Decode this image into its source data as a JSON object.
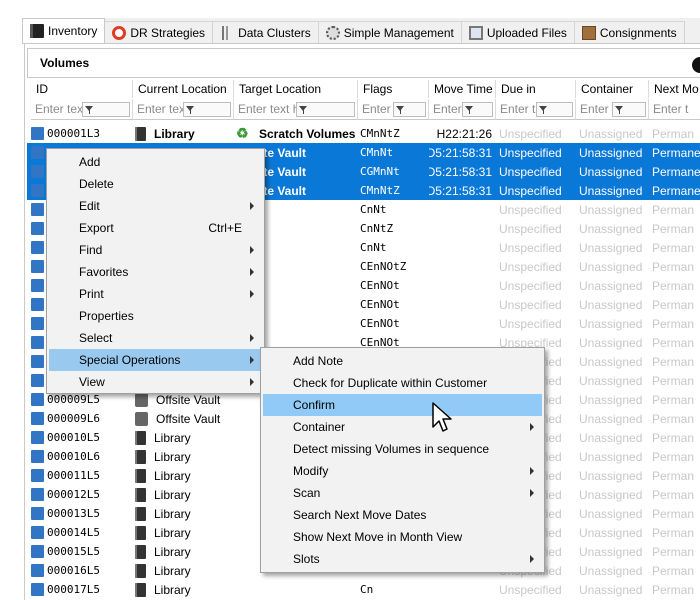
{
  "tabs": [
    {
      "label": "Inventory",
      "icon": "book-icon"
    },
    {
      "label": "DR Strategies",
      "icon": "lifebuoy-icon"
    },
    {
      "label": "Data Clusters",
      "icon": "bar-chart-icon"
    },
    {
      "label": "Simple Management",
      "icon": "gear-icon"
    },
    {
      "label": "Uploaded Files",
      "icon": "monitor-icon"
    },
    {
      "label": "Consignments",
      "icon": "box-icon"
    }
  ],
  "panel": {
    "title": "Volumes"
  },
  "columns": [
    {
      "label": "ID",
      "filter": "Enter text h..."
    },
    {
      "label": "Current Location",
      "filter": "Enter text h..."
    },
    {
      "label": "Target Location",
      "filter": "Enter text here"
    },
    {
      "label": "Flags",
      "filter": "Enter ..."
    },
    {
      "label": "Move Time",
      "filter": "Enter t..."
    },
    {
      "label": "Due in",
      "filter": "Enter t..."
    },
    {
      "label": "Container",
      "filter": "Enter t..."
    },
    {
      "label": "Next Mo",
      "filter": "Enter t"
    }
  ],
  "rows": [
    {
      "id": "000001L3",
      "current": "Library",
      "target": "Scratch Volumes",
      "flags": "CMnNtZ",
      "move": "H22:21:26",
      "due": "Unspecified",
      "container": "Unassigned",
      "next": "Perman"
    },
    {
      "id": "",
      "current": "",
      "target": "Offsite Vault",
      "flags": "CMnNt",
      "move": "D5:21:58:31",
      "due": "Unspecified",
      "container": "Unassigned",
      "next": "Permane"
    },
    {
      "id": "",
      "current": "",
      "target": "Offsite Vault",
      "flags": "CGMnNt",
      "move": "D5:21:58:31",
      "due": "Unspecified",
      "container": "Unassigned",
      "next": "Permane"
    },
    {
      "id": "",
      "current": "",
      "target": "Offsite Vault",
      "flags": "CMnNtZ",
      "move": "D5:21:58:31",
      "due": "Unspecified",
      "container": "Unassigned",
      "next": "Permane"
    },
    {
      "id": "",
      "current": "",
      "target": "",
      "flags": "CnNt",
      "move": "",
      "due": "Unspecified",
      "container": "Unassigned",
      "next": "Perman"
    },
    {
      "id": "",
      "current": "",
      "target": "",
      "flags": "CnNtZ",
      "move": "",
      "due": "Unspecified",
      "container": "Unassigned",
      "next": "Perman"
    },
    {
      "id": "",
      "current": "",
      "target": "",
      "flags": "CnNt",
      "move": "",
      "due": "Unspecified",
      "container": "Unassigned",
      "next": "Perman"
    },
    {
      "id": "",
      "current": "",
      "target": "",
      "flags": "CEnNOtZ",
      "move": "",
      "due": "Unspecified",
      "container": "Unassigned",
      "next": "Perman"
    },
    {
      "id": "",
      "current": "",
      "target": "",
      "flags": "CEnNOt",
      "move": "",
      "due": "Unspecified",
      "container": "Unassigned",
      "next": "Perman"
    },
    {
      "id": "",
      "current": "",
      "target": "",
      "flags": "CEnNOt",
      "move": "",
      "due": "Unspecified",
      "container": "Unassigned",
      "next": "Perman"
    },
    {
      "id": "",
      "current": "",
      "target": "",
      "flags": "CEnNOt",
      "move": "",
      "due": "Unspecified",
      "container": "Unassigned",
      "next": "Perman"
    },
    {
      "id": "",
      "current": "",
      "target": "",
      "flags": "CEnNOt",
      "move": "",
      "due": "Unspecified",
      "container": "Unassigned",
      "next": "Perman"
    },
    {
      "id": "",
      "current": "",
      "target": "",
      "flags": "",
      "move": "",
      "due": "Unspecified",
      "container": "Unassigned",
      "next": "Perman"
    },
    {
      "id": "",
      "current": "",
      "target": "",
      "flags": "",
      "move": "",
      "due": "Unspecified",
      "container": "Unassigned",
      "next": "Perman"
    },
    {
      "id": "000009L5",
      "current": "Offsite Vault",
      "target": "",
      "flags": "",
      "move": "",
      "due": "Unspecified",
      "container": "Unassigned",
      "next": "Perman"
    },
    {
      "id": "000009L6",
      "current": "Offsite Vault",
      "target": "",
      "flags": "",
      "move": "",
      "due": "Unspecified",
      "container": "Unassigned",
      "next": "Perman"
    },
    {
      "id": "000010L5",
      "current": "Library",
      "target": "",
      "flags": "",
      "move": "",
      "due": "Unspecified",
      "container": "Unassigned",
      "next": "Perman"
    },
    {
      "id": "000010L6",
      "current": "Library",
      "target": "",
      "flags": "",
      "move": "",
      "due": "Unspecified",
      "container": "Unassigned",
      "next": "Perman"
    },
    {
      "id": "000011L5",
      "current": "Library",
      "target": "",
      "flags": "",
      "move": "",
      "due": "Unspecified",
      "container": "Unassigned",
      "next": "Perman"
    },
    {
      "id": "000012L5",
      "current": "Library",
      "target": "",
      "flags": "",
      "move": "",
      "due": "Unspecified",
      "container": "Unassigned",
      "next": "Perman"
    },
    {
      "id": "000013L5",
      "current": "Library",
      "target": "",
      "flags": "",
      "move": "",
      "due": "Unspecified",
      "container": "Unassigned",
      "next": "Perman"
    },
    {
      "id": "000014L5",
      "current": "Library",
      "target": "",
      "flags": "",
      "move": "",
      "due": "Unspecified",
      "container": "Unassigned",
      "next": "Perman"
    },
    {
      "id": "000015L5",
      "current": "Library",
      "target": "",
      "flags": "",
      "move": "",
      "due": "Unspecified",
      "container": "Unassigned",
      "next": "Perman"
    },
    {
      "id": "000016L5",
      "current": "Library",
      "target": "",
      "flags": "",
      "move": "",
      "due": "Unspecified",
      "container": "Unassigned",
      "next": "Perman"
    },
    {
      "id": "000017L5",
      "current": "Library",
      "target": "",
      "flags": "Cn",
      "move": "",
      "due": "Unspecified",
      "container": "Unassigned",
      "next": "Perman"
    }
  ],
  "context_menu": [
    {
      "label": "Add",
      "shortcut": "",
      "submenu": false
    },
    {
      "label": "Delete",
      "shortcut": "",
      "submenu": false
    },
    {
      "label": "Edit",
      "shortcut": "",
      "submenu": true
    },
    {
      "label": "Export",
      "shortcut": "Ctrl+E",
      "submenu": false
    },
    {
      "label": "Find",
      "shortcut": "",
      "submenu": true
    },
    {
      "label": "Favorites",
      "shortcut": "",
      "submenu": true
    },
    {
      "label": "Print",
      "shortcut": "",
      "submenu": true
    },
    {
      "label": "Properties",
      "shortcut": "",
      "submenu": false
    },
    {
      "label": "Select",
      "shortcut": "",
      "submenu": true
    },
    {
      "label": "Special Operations",
      "shortcut": "",
      "submenu": true
    },
    {
      "label": "View",
      "shortcut": "",
      "submenu": true
    }
  ],
  "submenu": [
    {
      "label": "Add Note",
      "submenu": false
    },
    {
      "label": "Check for Duplicate within Customer",
      "submenu": false
    },
    {
      "label": "Confirm",
      "submenu": false
    },
    {
      "label": "Container",
      "submenu": true
    },
    {
      "label": "Detect missing Volumes in sequence",
      "submenu": false
    },
    {
      "label": "Modify",
      "submenu": true
    },
    {
      "label": "Scan",
      "submenu": true
    },
    {
      "label": "Search Next Move Dates",
      "submenu": false
    },
    {
      "label": "Show Next Move in Month View",
      "submenu": false
    },
    {
      "label": "Slots",
      "submenu": true
    }
  ],
  "colors": {
    "selection": "#0a78d7",
    "menu_highlight": "#99c9ef",
    "menu_bg": "#f2f2f2"
  }
}
